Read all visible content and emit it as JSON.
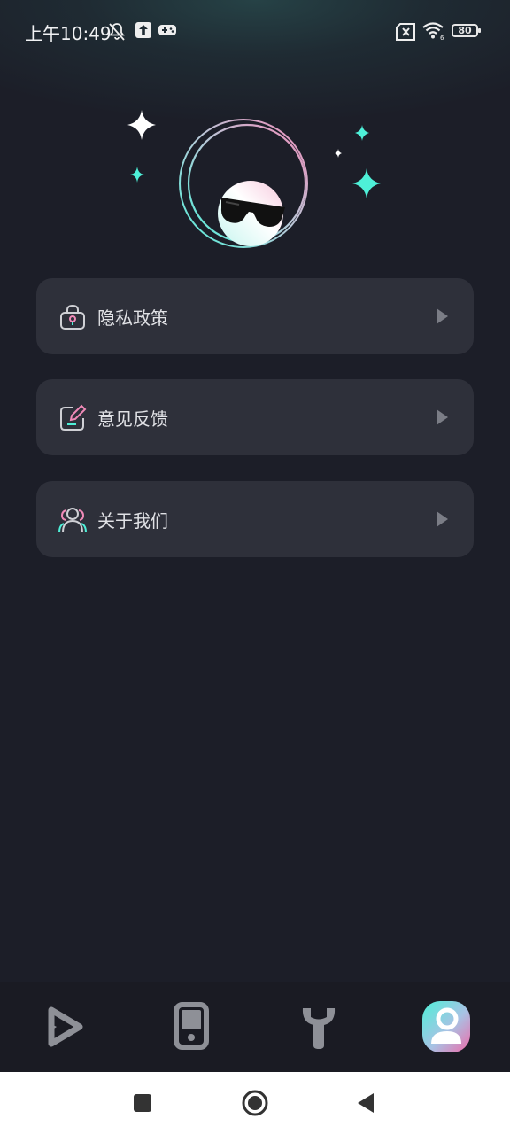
{
  "status_bar": {
    "time": "上午10:49",
    "battery": "80",
    "icons": [
      "mute-bell-icon",
      "upload-icon",
      "gamepad-icon",
      "no-sim-icon",
      "wifi-icon",
      "battery-icon"
    ]
  },
  "profile": {
    "avatar_icon": "sunglasses-face-icon",
    "decor": [
      "sparkle-icon"
    ]
  },
  "menu": {
    "items": [
      {
        "label": "隐私政策",
        "icon": "privacy-lock-icon"
      },
      {
        "label": "意见反馈",
        "icon": "feedback-edit-icon"
      },
      {
        "label": "关于我们",
        "icon": "about-users-icon"
      }
    ]
  },
  "tab_bar": {
    "tabs": [
      {
        "icon": "play-icon",
        "active": false
      },
      {
        "icon": "phone-icon",
        "active": false
      },
      {
        "icon": "wrench-icon",
        "active": false
      },
      {
        "icon": "profile-icon",
        "active": true
      }
    ]
  },
  "colors": {
    "background": "#1c1e28",
    "card": "#2e303a",
    "accent_cyan": "#4ef0d8",
    "accent_pink": "#f08ab8",
    "text": "#e0e1e5"
  }
}
